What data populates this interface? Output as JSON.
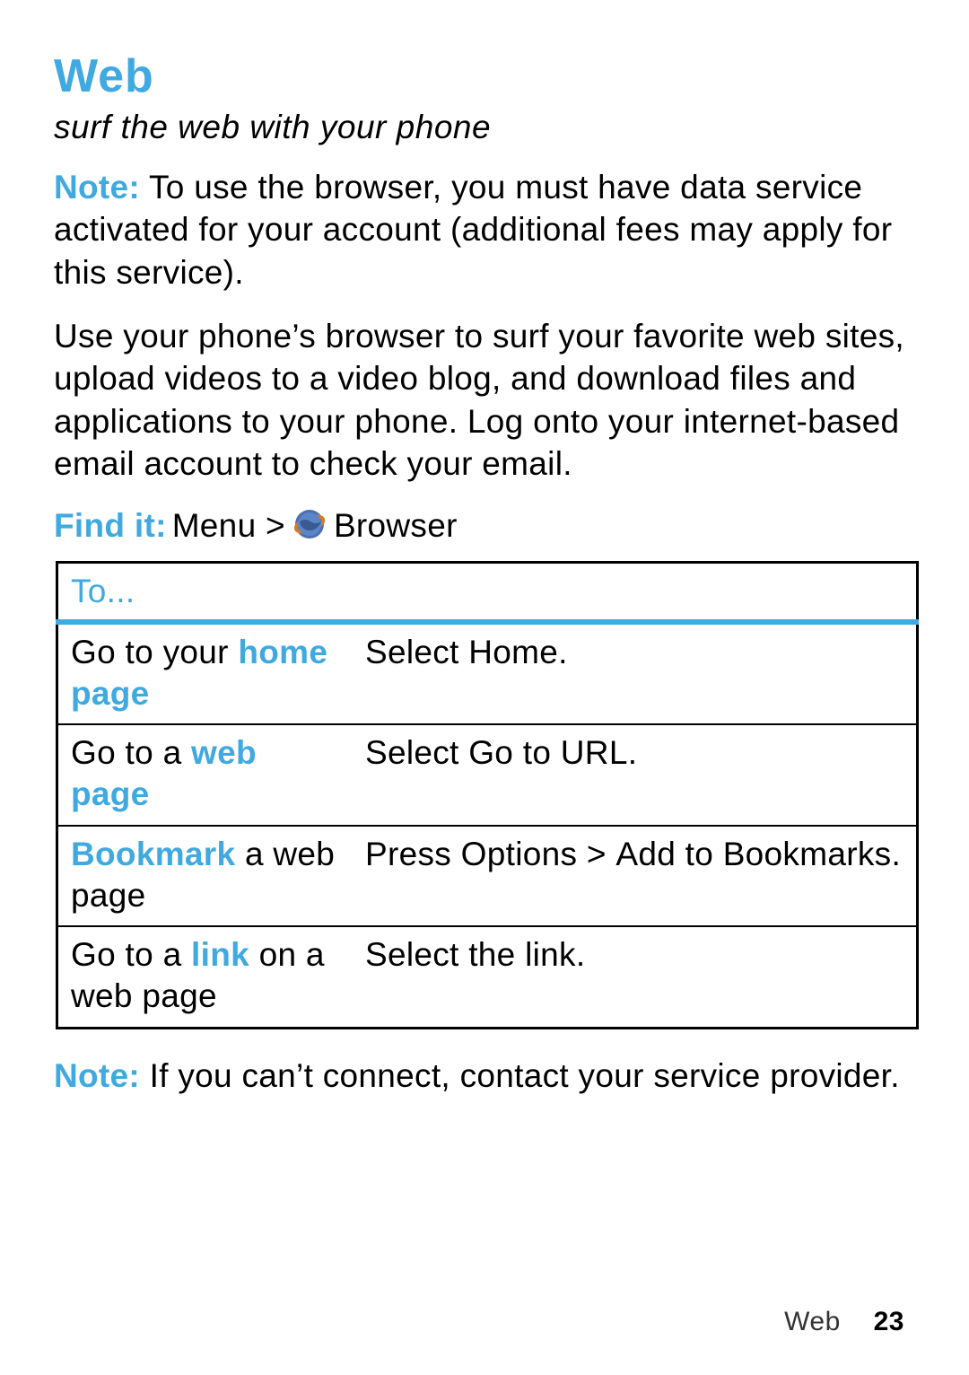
{
  "accent_color": "#3fa9e0",
  "heading": "Web",
  "subtitle": "surf the web with your phone",
  "note1_label": "Note:",
  "note1_text": " To use the browser, you must have data service activated for your account (additional fees may apply for this service).",
  "para2": "Use your phone’s browser to surf your favorite web sites, upload videos to a video blog, and download files and applications to your phone. Log onto your internet-based email account to check your email.",
  "find_it_label": "Find it:",
  "find_it_before_icon": " Menu > ",
  "find_it_after_icon": " Browser",
  "browser_icon_name": "browser-icon",
  "table_header": "To...",
  "rows": [
    {
      "left_pre": "Go to your ",
      "left_accent": "home page",
      "left_post": "",
      "right": "Select Home."
    },
    {
      "left_pre": "Go to a ",
      "left_accent": "web page",
      "left_post": "",
      "right": "Select Go to URL."
    },
    {
      "left_pre": "",
      "left_accent": "Bookmark",
      "left_post": " a web page",
      "right": "Press Options > Add to Bookmarks."
    },
    {
      "left_pre": "Go to a ",
      "left_accent": "link",
      "left_post": " on a web page",
      "right": "Select the link."
    }
  ],
  "note2_label": "Note:",
  "note2_text": " If you can’t connect, contact your service provider.",
  "footer_section": "Web",
  "footer_page": "23"
}
